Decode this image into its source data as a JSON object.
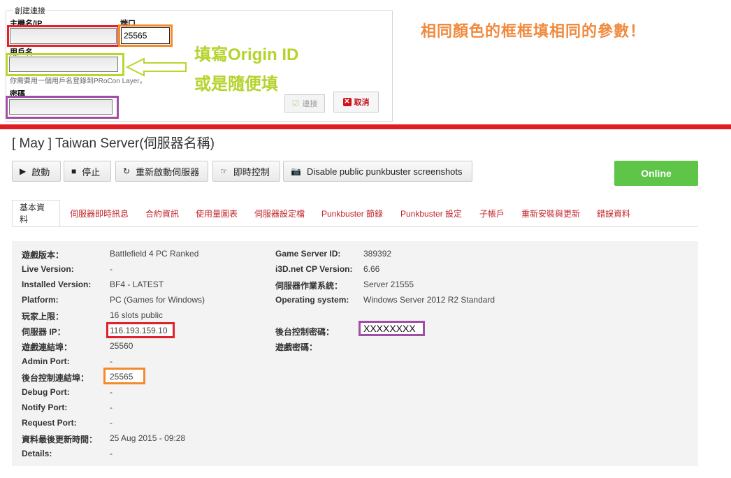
{
  "connect": {
    "legend": "創建連接",
    "host_label": "主機名/IP",
    "port_label": "端口",
    "port_value": "25565",
    "username_label": "用戶名",
    "hint": "你需要用一個用戶名登錄到PRoCon Layer。",
    "password_label": "密碼",
    "connect_label": "連接",
    "cancel_label": "取消"
  },
  "annotations": {
    "fill_origin": "填寫Origin ID",
    "or_random": "或是隨便填",
    "same_color": "相同顏色的框框填相同的參數！"
  },
  "server": {
    "title": "[ May ] Taiwan Server(伺服器名稱)",
    "status": "Online"
  },
  "toolbar": [
    {
      "label": "啟動",
      "icon": "play-icon"
    },
    {
      "label": "停止",
      "icon": "stop-icon"
    },
    {
      "label": "重新啟動伺服器",
      "icon": "refresh-icon"
    },
    {
      "label": "即時控制",
      "icon": "hand-pointer-icon"
    },
    {
      "label": "Disable public punkbuster screenshots",
      "icon": "camera-icon"
    }
  ],
  "tabs": [
    "基本資料",
    "伺服器即時訊息",
    "合約資訊",
    "使用量圖表",
    "伺服器設定檔",
    "Punkbuster 節錄",
    "Punkbuster 設定",
    "子帳戶",
    "重新安裝與更新",
    "錯誤資料"
  ],
  "info_left": [
    {
      "k": "遊戲版本：",
      "v": "Battlefield 4 PC Ranked"
    },
    {
      "k": "Live Version:",
      "v": "-"
    },
    {
      "k": "Installed Version:",
      "v": "BF4 - LATEST"
    },
    {
      "k": "Platform:",
      "v": "PC (Games for Windows)"
    },
    {
      "k": "玩家上限：",
      "v": "16 slots public"
    },
    {
      "k": "伺服器 IP：",
      "v": "116.193.159.10"
    },
    {
      "k": "遊戲連結埠：",
      "v": "25560"
    },
    {
      "k": "Admin Port:",
      "v": "-"
    },
    {
      "k": "後台控制連結埠：",
      "v": "25565"
    },
    {
      "k": "Debug Port:",
      "v": "-"
    },
    {
      "k": "Notify Port:",
      "v": "-"
    },
    {
      "k": "Request Port:",
      "v": "-"
    },
    {
      "k": "資料最後更新時間：",
      "v": "25 Aug 2015 - 09:28"
    },
    {
      "k": "Details:",
      "v": "-"
    }
  ],
  "info_right": [
    {
      "k": "Game Server ID:",
      "v": "389392"
    },
    {
      "k": "i3D.net CP Version:",
      "v": "6.66"
    },
    {
      "k": "伺服器作業系統：",
      "v": "Server 21555"
    },
    {
      "k": "Operating system:",
      "v": "Windows Server 2012 R2 Standard"
    },
    {
      "k": "",
      "v": ""
    },
    {
      "k": "後台控制密碼：",
      "v": "XXXXXXXX"
    },
    {
      "k": "遊戲密碼：",
      "v": ""
    }
  ],
  "colors": {
    "red": "#e0222a",
    "orange": "#f58a2a",
    "lime": "#b6d72c",
    "purple": "#a14ea6",
    "online": "#5ec549",
    "tab_link": "#c2252b"
  }
}
